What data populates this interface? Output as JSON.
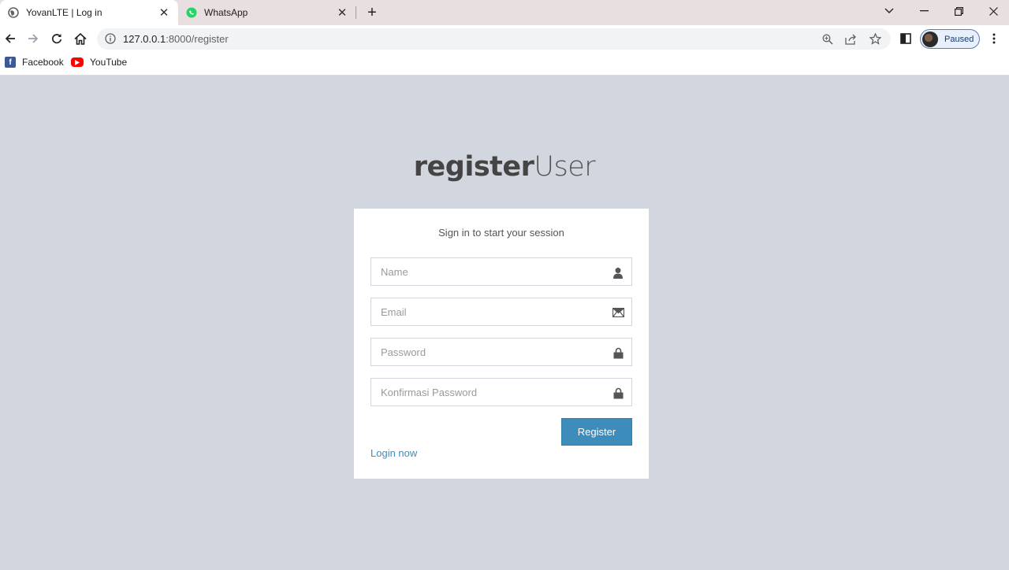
{
  "browser": {
    "tabs": [
      {
        "title": "YovanLTE | Log in",
        "active": true
      },
      {
        "title": "WhatsApp",
        "active": false
      }
    ],
    "url": {
      "host": "127.0.0.1",
      "port_path": ":8000/register"
    },
    "profile_label": "Paused",
    "bookmarks": [
      {
        "label": "Facebook",
        "icon": "facebook-icon",
        "color": "#1877f2"
      },
      {
        "label": "YouTube",
        "icon": "youtube-icon",
        "color": "#ff0000"
      }
    ]
  },
  "page": {
    "logo_bold": "register",
    "logo_light": "User",
    "box_message": "Sign in to start your session",
    "fields": {
      "name_placeholder": "Name",
      "email_placeholder": "Email",
      "password_placeholder": "Password",
      "confirm_placeholder": "Konfirmasi Password"
    },
    "register_label": "Register",
    "login_link": "Login now"
  },
  "colors": {
    "background": "#d2d6de",
    "primary": "#3c8dbc"
  }
}
